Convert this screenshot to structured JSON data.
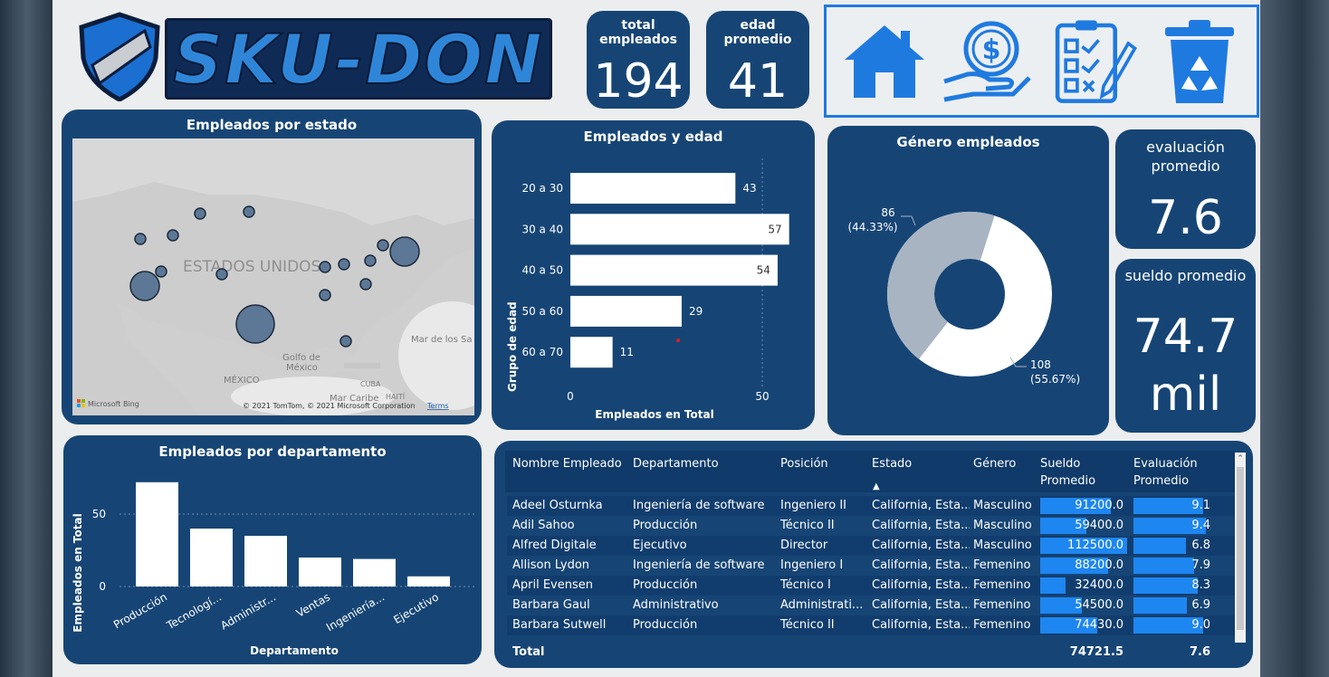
{
  "brand": {
    "logo_text": "SKU-DON"
  },
  "kpis": {
    "total_employees": {
      "label_line1": "total",
      "label_line2": "empleados",
      "value": "194"
    },
    "avg_age": {
      "label_line1": "edad",
      "label_line2": "promedio",
      "value": "41"
    },
    "avg_eval": {
      "label_line1": "evaluación",
      "label_line2": "promedio",
      "value": "7.6"
    },
    "avg_salary": {
      "label": "sueldo promedio",
      "value_line1": "74.7",
      "value_line2": "mil"
    }
  },
  "nav": [
    {
      "icon": "home-icon"
    },
    {
      "icon": "salary-icon"
    },
    {
      "icon": "checklist-icon"
    },
    {
      "icon": "recycle-bin-icon"
    }
  ],
  "map": {
    "title": "Empleados por estado",
    "labels": {
      "country": "ESTADOS UNIDOS",
      "gulf_line1": "Golfo de",
      "gulf_line2": "México",
      "mexico": "MÉXICO",
      "cuba": "CUBA",
      "sea": "Mar de los Sa",
      "haiti": "HAITÍ",
      "caribe": "Mar Caribe"
    },
    "attribution": "© 2021 TomTom, © 2021 Microsoft Corporation",
    "terms": "Terms",
    "bing": "Microsoft Bing"
  },
  "age_chart": {
    "title": "Empleados y edad",
    "ylabel": "Grupo de edad",
    "xlabel": "Empleados en Total",
    "xticks": [
      "0",
      "50"
    ]
  },
  "gender_chart": {
    "title": "Género empleados",
    "label_gray_line1": "86",
    "label_gray_line2": "(44.33%)",
    "label_white_line1": "108",
    "label_white_line2": "(55.67%)"
  },
  "dept_chart": {
    "title": "Empleados por departamento",
    "ylabel": "Empleados en Total",
    "xlabel": "Departamento",
    "yticks": [
      "0",
      "50"
    ]
  },
  "chart_data": [
    {
      "type": "bar",
      "title": "Empleados y edad",
      "categories": [
        "20 a 30",
        "30 a 40",
        "40 a 50",
        "50 a 60",
        "60 a 70"
      ],
      "values": [
        43,
        57,
        54,
        29,
        11
      ],
      "xlabel": "Empleados en Total",
      "ylabel": "Grupo de edad",
      "xlim": [
        0,
        60
      ]
    },
    {
      "type": "pie",
      "title": "Género empleados",
      "values": [
        86,
        108
      ]
    },
    {
      "type": "bar",
      "title": "Empleados por departamento",
      "categories": [
        "Producción",
        "Tecnologí...",
        "Administr...",
        "Ventas",
        "Ingeniería...",
        "Ejecutivo"
      ],
      "values": [
        72,
        40,
        35,
        20,
        19,
        7
      ],
      "xlabel": "Departamento",
      "ylabel": "Empleados en Total",
      "ylim": [
        0,
        80
      ]
    }
  ],
  "table": {
    "headers": [
      "Nombre Empleado",
      "Departamento",
      "Posición",
      "Estado",
      "Género",
      "Sueldo Promedio",
      "Evaluación Promedio"
    ],
    "header_sueldo_line1": "Sueldo",
    "header_sueldo_line2": "Promedio",
    "header_eval_line1": "Evaluación",
    "header_eval_line2": "Promedio",
    "sort_indicator": "▲",
    "rows": [
      {
        "name": "Adeel Osturnka",
        "dept": "Ingeniería de software",
        "pos": "Ingeniero II",
        "state": "California, Esta...",
        "gender": "Masculino",
        "salary": "91200.0",
        "salary_frac": 0.81,
        "eval": "9.1",
        "eval_frac": 0.91
      },
      {
        "name": "Adil Sahoo",
        "dept": "Producción",
        "pos": "Técnico II",
        "state": "California, Esta...",
        "gender": "Masculino",
        "salary": "59400.0",
        "salary_frac": 0.53,
        "eval": "9.4",
        "eval_frac": 0.94
      },
      {
        "name": "Alfred Digitale",
        "dept": "Ejecutivo",
        "pos": "Director",
        "state": "California, Esta...",
        "gender": "Masculino",
        "salary": "112500.0",
        "salary_frac": 1.0,
        "eval": "6.8",
        "eval_frac": 0.68
      },
      {
        "name": "Allison Lydon",
        "dept": "Ingeniería de software",
        "pos": "Ingeniero I",
        "state": "California, Esta...",
        "gender": "Femenino",
        "salary": "88200.0",
        "salary_frac": 0.78,
        "eval": "7.9",
        "eval_frac": 0.79
      },
      {
        "name": "April Evensen",
        "dept": "Producción",
        "pos": "Técnico I",
        "state": "California, Esta...",
        "gender": "Femenino",
        "salary": "32400.0",
        "salary_frac": 0.29,
        "eval": "8.3",
        "eval_frac": 0.83
      },
      {
        "name": "Barbara Gaul",
        "dept": "Administrativo",
        "pos": "Administrati...",
        "state": "California, Esta...",
        "gender": "Femenino",
        "salary": "54500.0",
        "salary_frac": 0.48,
        "eval": "6.9",
        "eval_frac": 0.69
      },
      {
        "name": "Barbara Sutwell",
        "dept": "Producción",
        "pos": "Técnico II",
        "state": "California, Esta...",
        "gender": "Femenino",
        "salary": "74430.0",
        "salary_frac": 0.66,
        "eval": "9.0",
        "eval_frac": 0.9
      }
    ],
    "total_label": "Total",
    "total_salary": "74721.5",
    "total_eval": "7.6"
  },
  "colors": {
    "panel": "#164575",
    "accent": "#1e86f0",
    "icon": "#1f7ae0",
    "donut_gray": "#a9b4c2"
  }
}
